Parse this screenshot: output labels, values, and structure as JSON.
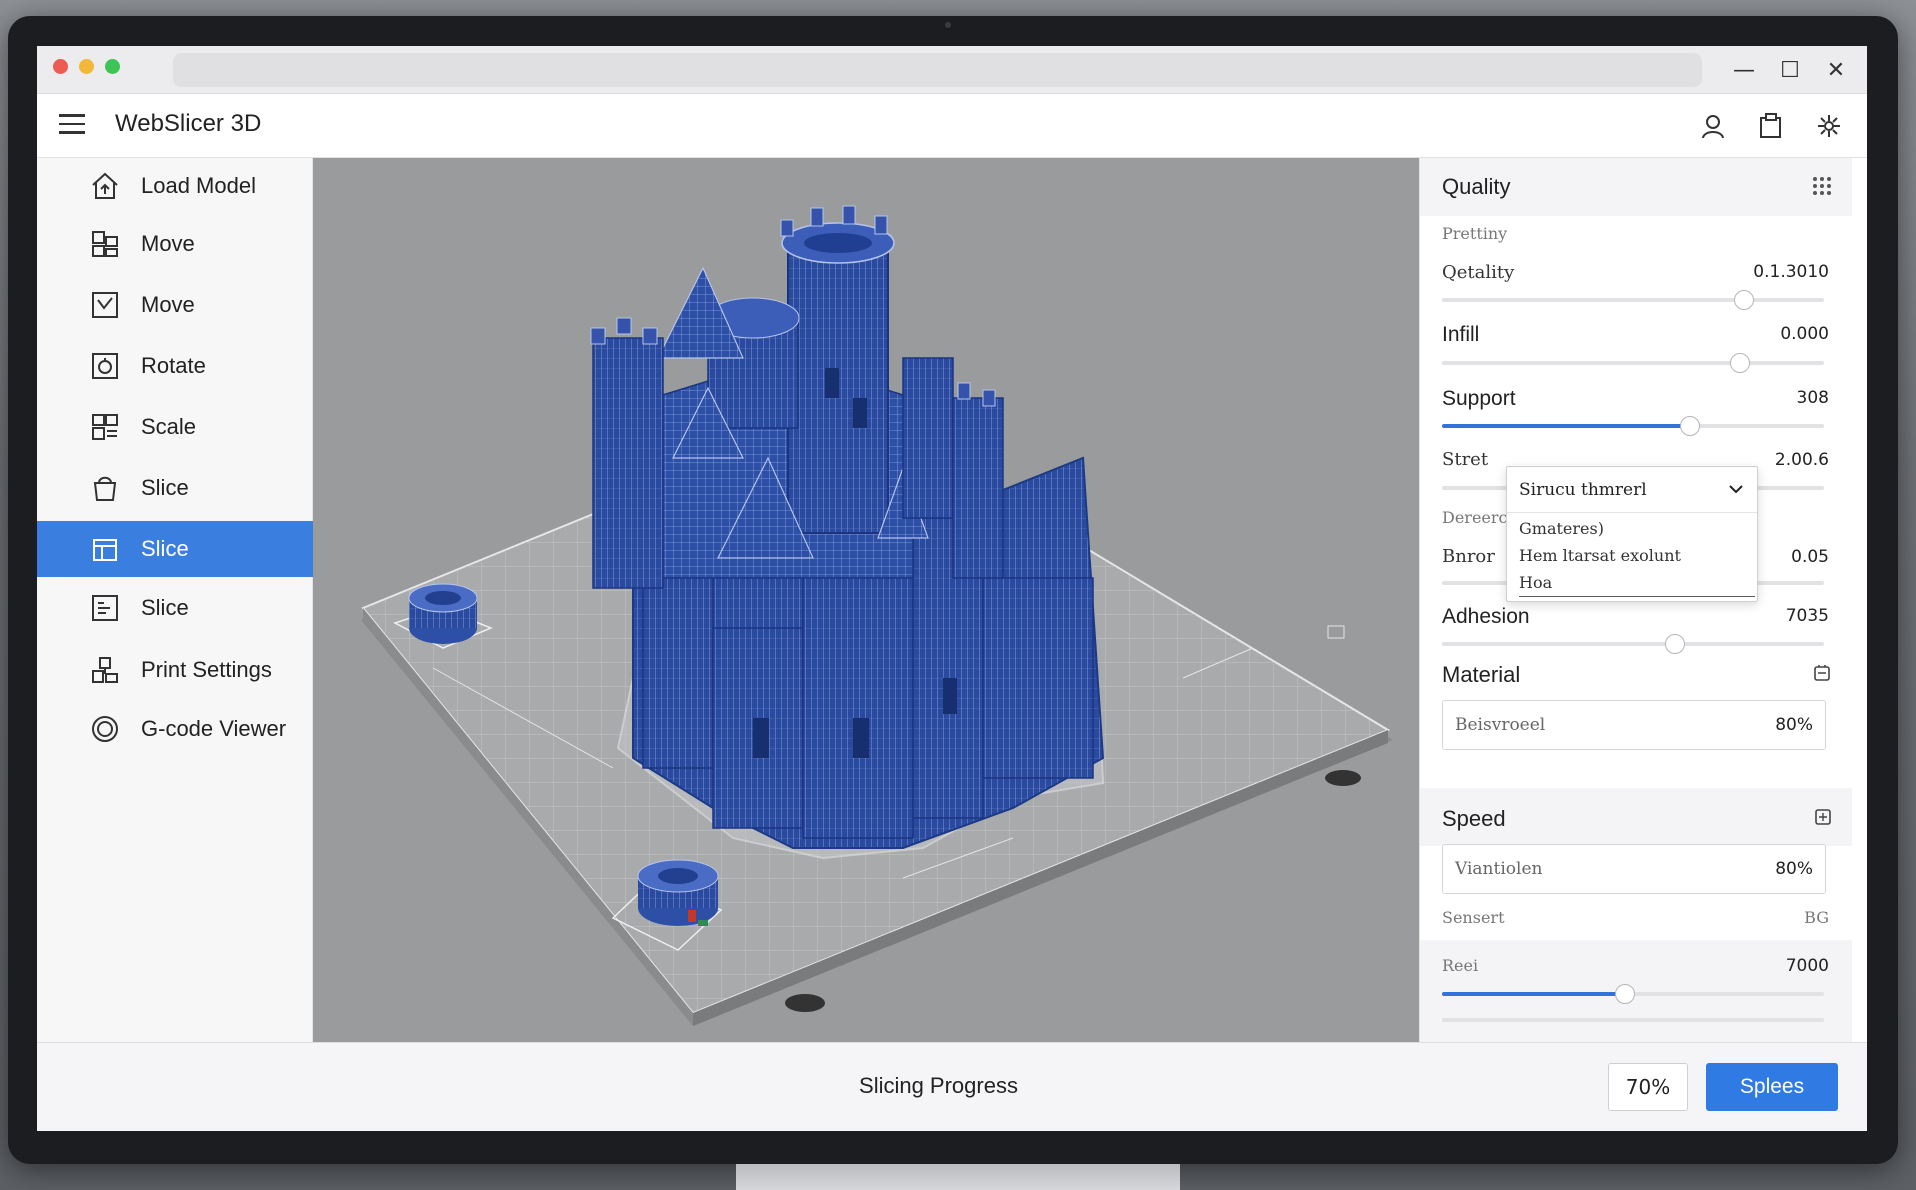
{
  "app": {
    "title": "WebSlicer 3D"
  },
  "window_controls": {
    "minimize": "—",
    "maximize": "☐",
    "close": "✕"
  },
  "sidebar": {
    "items": [
      {
        "label": "Load Model",
        "icon": "home-upload-icon",
        "active": false
      },
      {
        "label": "Move",
        "icon": "move-icon",
        "active": false
      },
      {
        "label": "Move",
        "icon": "move-check-icon",
        "active": false
      },
      {
        "label": "Rotate",
        "icon": "rotate-icon",
        "active": false
      },
      {
        "label": "Scale",
        "icon": "scale-icon",
        "active": false
      },
      {
        "label": "Slice",
        "icon": "slice-icon",
        "active": false
      },
      {
        "label": "Slice",
        "icon": "slice-active-icon",
        "active": true
      },
      {
        "label": "Slice",
        "icon": "slice-layers-icon",
        "active": false
      },
      {
        "label": "Print Settings",
        "icon": "print-settings-icon",
        "active": false
      },
      {
        "label": "G-code Viewer",
        "icon": "gcode-viewer-icon",
        "active": false
      }
    ]
  },
  "panel": {
    "quality": {
      "title": "Quality",
      "subheading": "Prettiny",
      "rows": [
        {
          "label": "Qetality",
          "value": "0.1.3010",
          "level": 0.79,
          "filled": false
        },
        {
          "label": "Infill",
          "value": "0.000",
          "level": 0.78,
          "filled": false
        },
        {
          "label": "Support",
          "value": "308",
          "level": 0.65,
          "filled": true
        },
        {
          "label": "Stret",
          "value": "2.00.6",
          "level": null,
          "filled": false
        }
      ],
      "dropdown": {
        "selected": "Sirucu thmrerl",
        "options": [
          "Gmateres)",
          "Hem ltarsat exolunt",
          "Hoa"
        ]
      },
      "partial_label": "Dereerca",
      "error_row": {
        "label": "Bnror",
        "value": "0.05"
      },
      "adhesion": {
        "label": "Adhesion",
        "value": "7035",
        "level": 0.61
      }
    },
    "material": {
      "title": "Material",
      "field_placeholder": "Beisvroeel",
      "field_value": "80%"
    },
    "speed": {
      "title": "Speed",
      "field_placeholder": "Viantiolen",
      "field_value": "80%",
      "sub_label": "Sensert",
      "sub_value": "BG",
      "row": {
        "label": "Reei",
        "value": "7000",
        "level": 0.48
      }
    }
  },
  "footer": {
    "progress_label": "Slicing Progress",
    "percent": "70%",
    "progress": 0.7,
    "slice_button": "Splees"
  },
  "colors": {
    "accent": "#3a7fe0",
    "model_blue": "#2a4ea8",
    "viewport_bg": "#9a9b9d"
  }
}
